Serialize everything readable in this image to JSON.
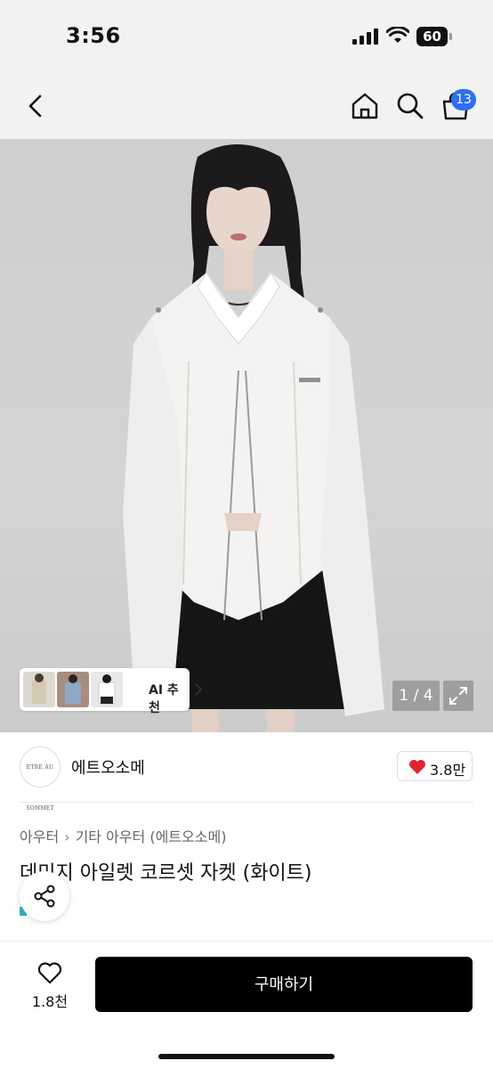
{
  "status_bar": {
    "time": "3:56",
    "battery_level": "60",
    "icons": [
      "signal-icon",
      "wifi-icon",
      "battery-icon"
    ]
  },
  "nav": {
    "icons": [
      "back-icon",
      "home-icon",
      "search-icon",
      "cart-icon"
    ],
    "cart_badge": "13"
  },
  "gallery": {
    "ai_label": "AI 추천",
    "page_counter": "1 / 4",
    "icons": [
      "chevron-right-icon",
      "expand-icon"
    ]
  },
  "shop": {
    "name": "에트오소메",
    "avatar_text": "ETRE AU SOMMET",
    "like_count": "3.8만"
  },
  "product": {
    "breadcrumb": [
      "아우터",
      "기타 아우터 (에트오소메)"
    ],
    "title": "데미지 아일렛 코르셋 자켓 (화이트)"
  },
  "bottom": {
    "wish_count": "1.8천",
    "buy_label": "구매하기"
  },
  "colors": {
    "accent_badge": "#2d6ef0",
    "heart": "#e0242e",
    "buy_button": "#000000"
  }
}
